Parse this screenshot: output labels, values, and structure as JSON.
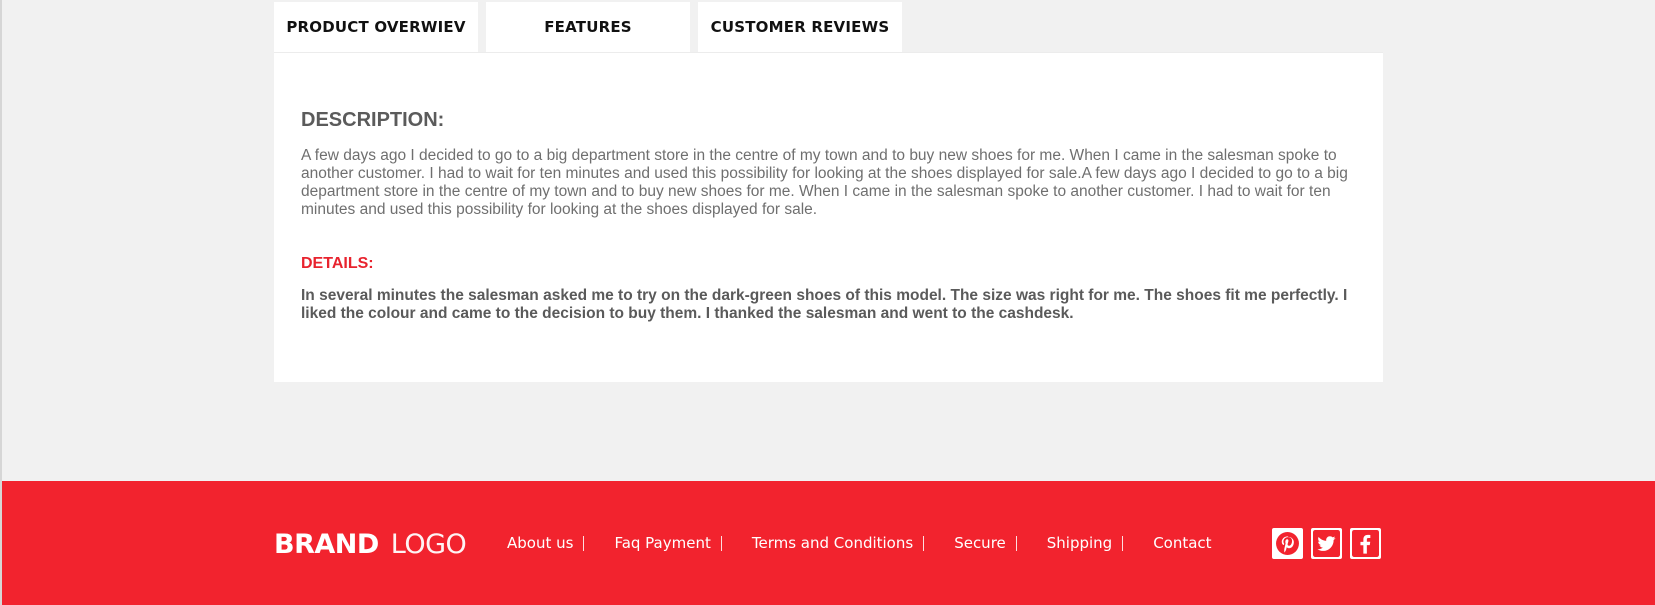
{
  "tabs": [
    {
      "label": "PRODUCT OVERWIEV"
    },
    {
      "label": "FEATURES"
    },
    {
      "label": "CUSTOMER REVIEWS"
    }
  ],
  "description": {
    "heading": "DESCRIPTION:",
    "text": "A few days ago I decided to go to a big department store in the centre of my town and to buy new shoes for me. When I came in the salesman spoke to another customer. I had to wait for ten minutes and used this possibility for looking at the shoes displayed for sale.A few days ago I decided to go to a big department store in the centre of my town and to buy new shoes for me. When I came in the salesman spoke to another customer. I had to wait for ten minutes and used this possibility for looking at the shoes displayed for sale."
  },
  "details": {
    "heading": "DETAILS:",
    "text": "In several minutes the salesman asked me to try on the dark-green shoes of this model. The size was right for me. The shoes fit me perfectly. I liked the colour and came to the decision to buy them. I thanked the salesman and went to the cashdesk."
  },
  "footer": {
    "logo_brand": "BRAND",
    "logo_logo": "LOGO",
    "links": [
      {
        "label": "About us"
      },
      {
        "label": "Faq Payment"
      },
      {
        "label": "Terms and Conditions"
      },
      {
        "label": "Secure"
      },
      {
        "label": "Shipping"
      },
      {
        "label": "Contact"
      }
    ],
    "social": [
      {
        "icon": "pinterest-icon"
      },
      {
        "icon": "twitter-icon"
      },
      {
        "icon": "facebook-icon"
      }
    ]
  },
  "colors": {
    "accent": "#f2232e",
    "page_background": "#f1f1f1",
    "panel_background": "#ffffff",
    "text_gray": "#6f6f6f"
  }
}
